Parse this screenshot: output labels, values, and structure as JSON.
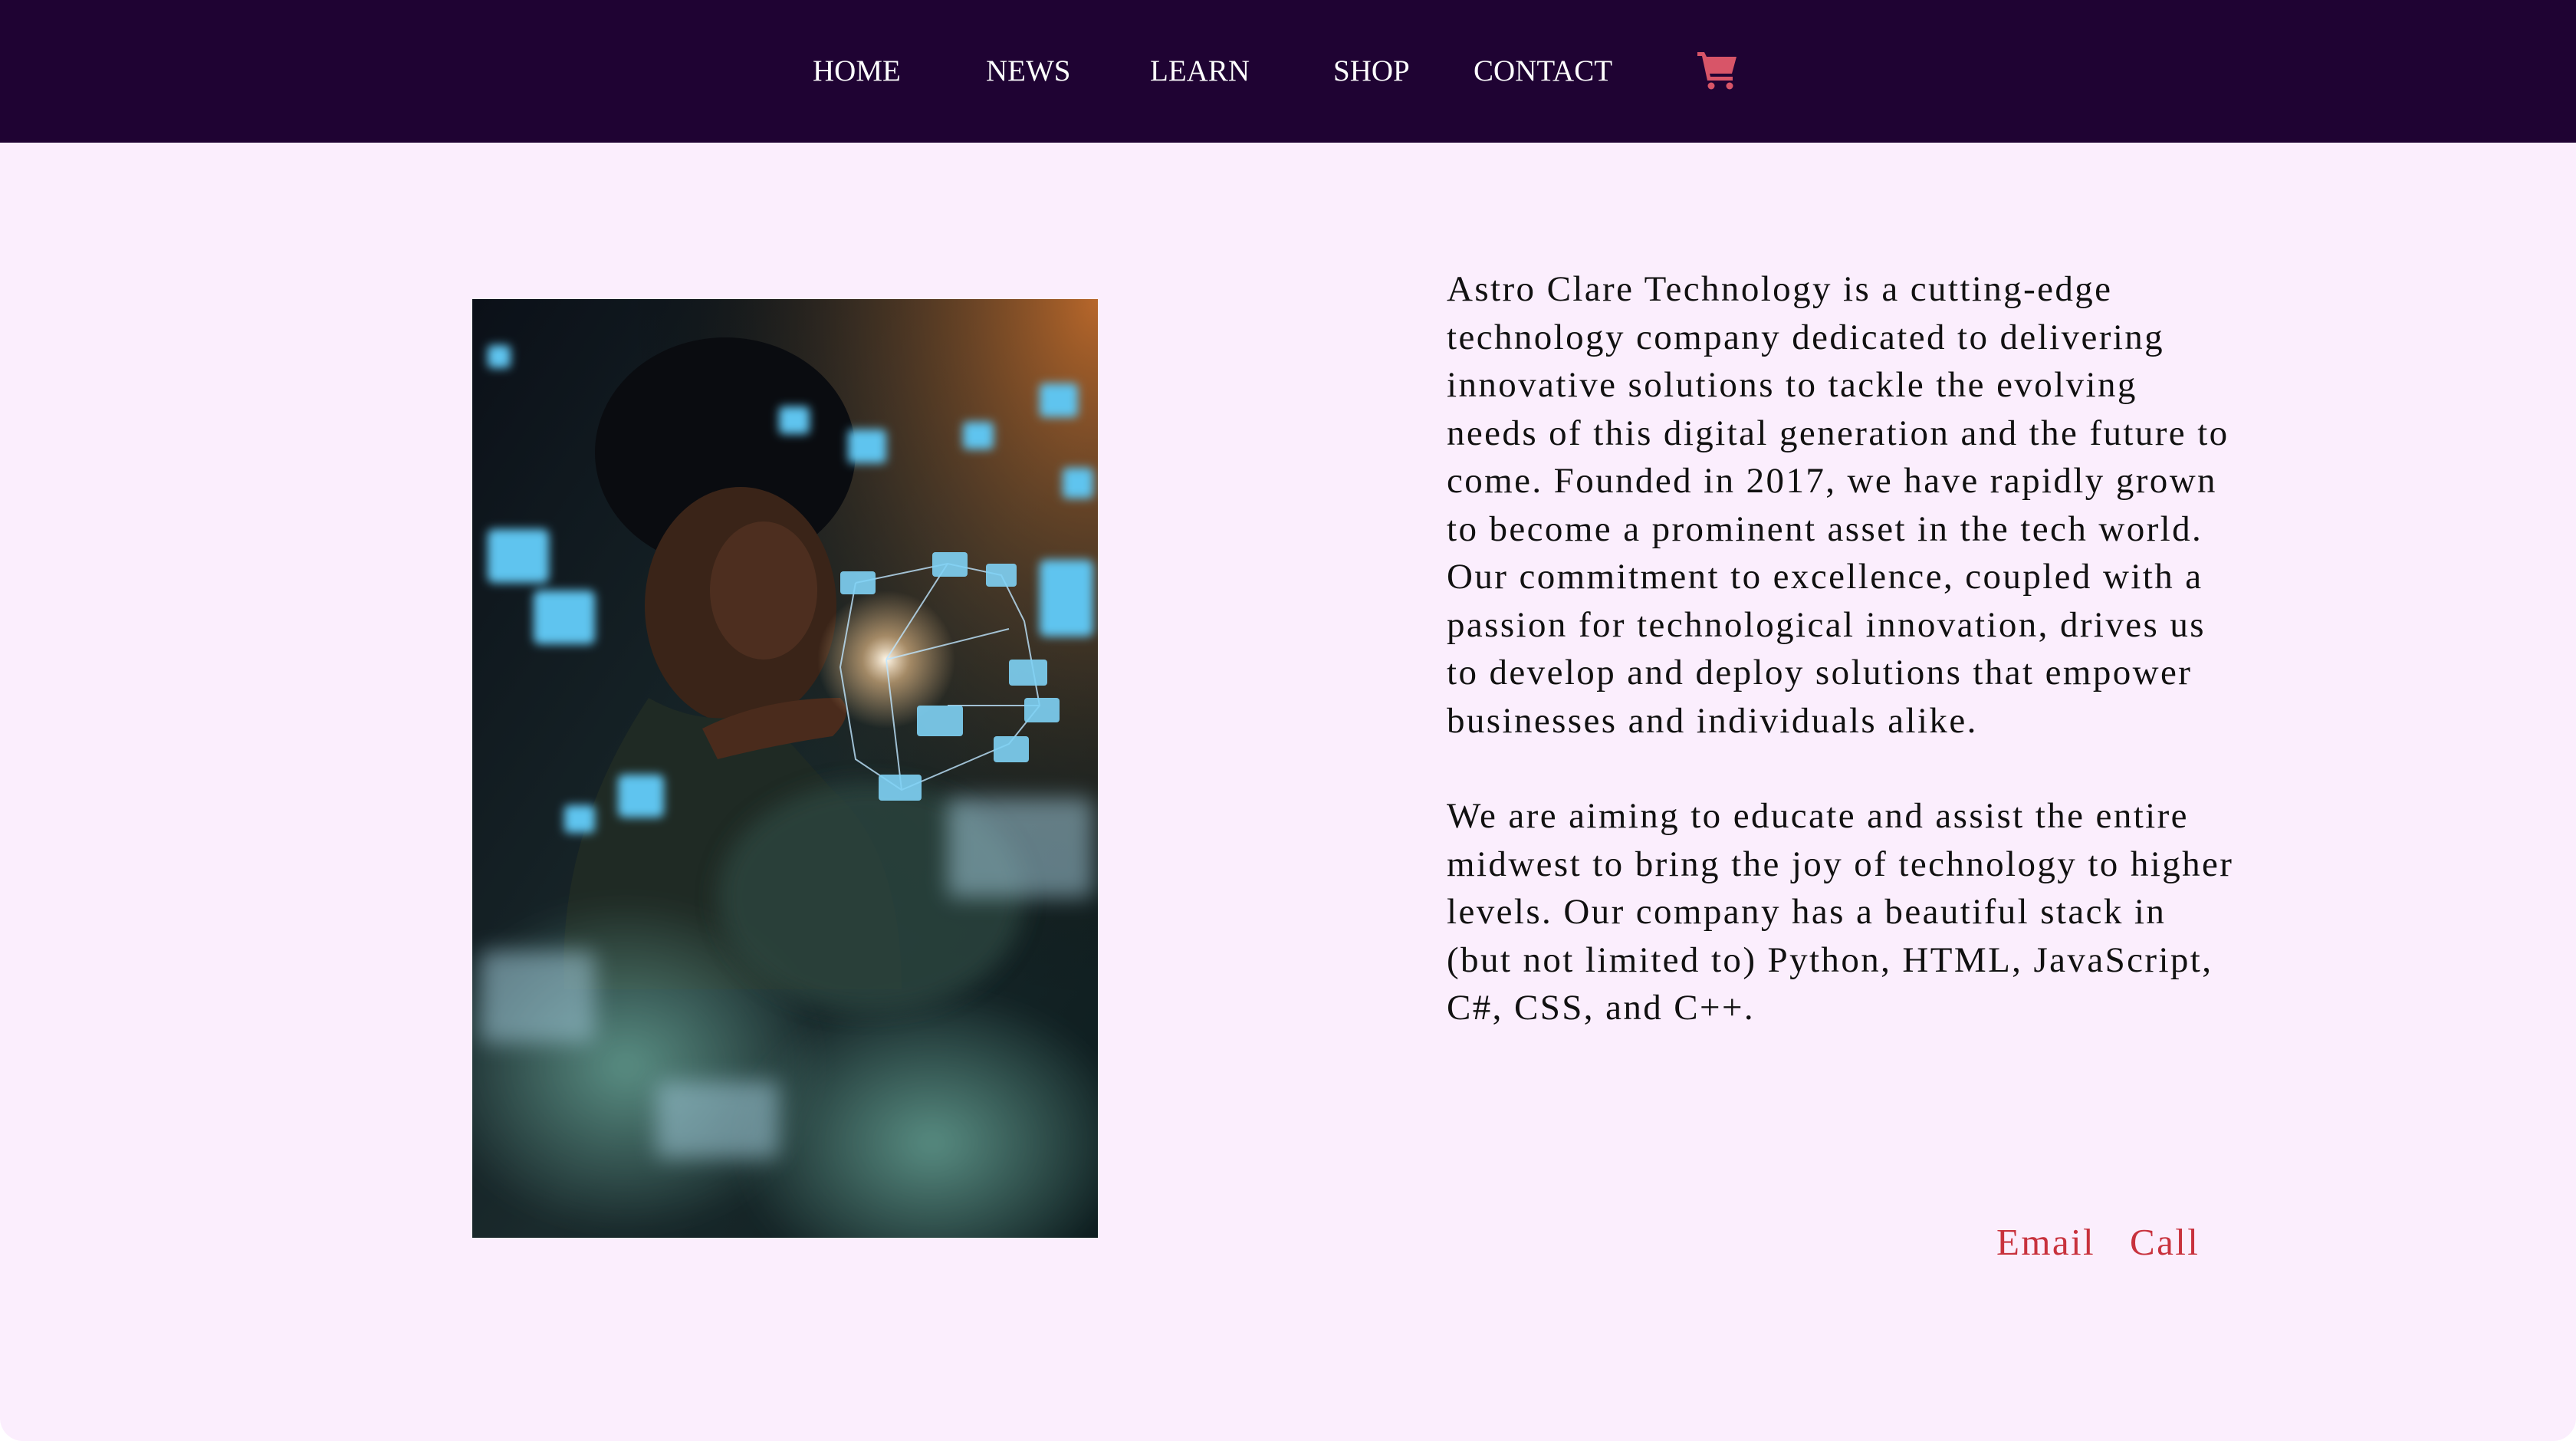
{
  "nav": {
    "items": [
      {
        "label": "HOME"
      },
      {
        "label": "NEWS"
      },
      {
        "label": "LEARN"
      },
      {
        "label": "SHOP"
      },
      {
        "label": "CONTACT"
      }
    ],
    "cart_icon": "shopping-cart-icon"
  },
  "colors": {
    "nav_background": "#1f0333",
    "page_background": "#fbeefd",
    "accent": "#c8323d",
    "nav_text": "#ffffff"
  },
  "main": {
    "image": "woman-with-holographic-tech-photo",
    "paragraphs": [
      "Astro Clare Technology is a cutting-edge technology company dedicated to delivering innovative solutions to tackle the evolving needs of this digital generation and the future to come. Founded in 2017, we have rapidly grown to become a prominent asset in the tech world. Our commitment to excellence, coupled with a passion for technological innovation, drives us to develop and deploy solutions that empower businesses and individuals alike.",
      "We are aiming to educate and assist the entire midwest to bring the joy of technology to higher levels. Our company has a beautiful stack in (but not limited to) Python, HTML, JavaScript, C#, CSS, and C++."
    ],
    "links": {
      "email": "Email",
      "call": "Call"
    }
  }
}
